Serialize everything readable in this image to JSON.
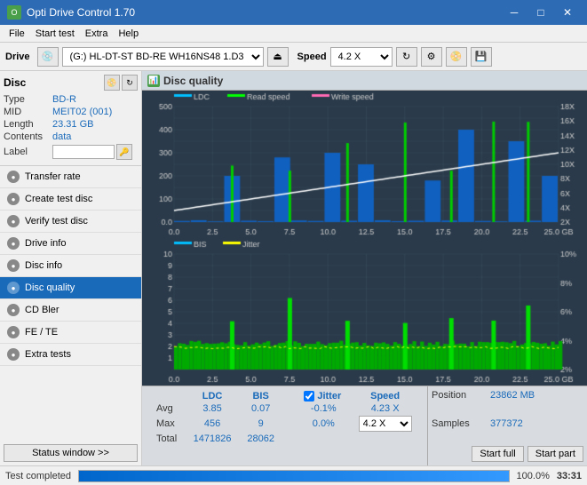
{
  "app": {
    "title": "Opti Drive Control 1.70",
    "icon_label": "O"
  },
  "title_controls": {
    "minimize": "─",
    "maximize": "□",
    "close": "✕"
  },
  "menu": {
    "items": [
      "File",
      "Start test",
      "Extra",
      "Help"
    ]
  },
  "drive_toolbar": {
    "drive_label": "Drive",
    "drive_value": "(G:)  HL-DT-ST BD-RE  WH16NS48 1.D3",
    "speed_label": "Speed",
    "speed_value": "4.2 X"
  },
  "disc": {
    "title": "Disc",
    "type_label": "Type",
    "type_value": "BD-R",
    "mid_label": "MID",
    "mid_value": "MEIT02 (001)",
    "length_label": "Length",
    "length_value": "23.31 GB",
    "contents_label": "Contents",
    "contents_value": "data",
    "label_label": "Label",
    "label_value": ""
  },
  "nav_items": [
    {
      "id": "transfer-rate",
      "label": "Transfer rate",
      "active": false
    },
    {
      "id": "create-test-disc",
      "label": "Create test disc",
      "active": false
    },
    {
      "id": "verify-test-disc",
      "label": "Verify test disc",
      "active": false
    },
    {
      "id": "drive-info",
      "label": "Drive info",
      "active": false
    },
    {
      "id": "disc-info",
      "label": "Disc info",
      "active": false
    },
    {
      "id": "disc-quality",
      "label": "Disc quality",
      "active": true
    },
    {
      "id": "cd-bler",
      "label": "CD Bler",
      "active": false
    },
    {
      "id": "fe-te",
      "label": "FE / TE",
      "active": false
    },
    {
      "id": "extra-tests",
      "label": "Extra tests",
      "active": false
    }
  ],
  "status_window_btn": "Status window >>",
  "chart": {
    "title": "Disc quality",
    "legend": {
      "ldc": "LDC",
      "read_speed": "Read speed",
      "write_speed": "Write speed"
    },
    "legend2": {
      "bis": "BIS",
      "jitter": "Jitter"
    },
    "y_axis_top": [
      "500",
      "400",
      "300",
      "200",
      "100",
      "0.0"
    ],
    "y_axis_right_top": [
      "18X",
      "16X",
      "14X",
      "12X",
      "10X",
      "8X",
      "6X",
      "4X",
      "2X"
    ],
    "x_axis": [
      "0.0",
      "2.5",
      "5.0",
      "7.5",
      "10.0",
      "12.5",
      "15.0",
      "17.5",
      "20.0",
      "22.5",
      "25.0 GB"
    ],
    "y_axis_bottom": [
      "10",
      "9",
      "8",
      "7",
      "6",
      "5",
      "4",
      "3",
      "2",
      "1"
    ],
    "y_axis_right_bottom": [
      "10%",
      "8%",
      "6%",
      "4%",
      "2%"
    ]
  },
  "stats": {
    "headers": [
      "LDC",
      "BIS",
      "",
      "Jitter",
      "Speed",
      ""
    ],
    "avg_label": "Avg",
    "avg_ldc": "3.85",
    "avg_bis": "0.07",
    "avg_jitter": "-0.1%",
    "max_label": "Max",
    "max_ldc": "456",
    "max_bis": "9",
    "max_jitter": "0.0%",
    "total_label": "Total",
    "total_ldc": "1471826",
    "total_bis": "28062",
    "jitter_checked": true,
    "jitter_label": "Jitter",
    "speed_value": "4.23 X",
    "speed_select": "4.2 X",
    "position_label": "Position",
    "position_value": "23862 MB",
    "samples_label": "Samples",
    "samples_value": "377372",
    "start_full_btn": "Start full",
    "start_part_btn": "Start part"
  },
  "progress": {
    "status_text": "Test completed",
    "percent": "100.0%",
    "time": "33:31"
  }
}
